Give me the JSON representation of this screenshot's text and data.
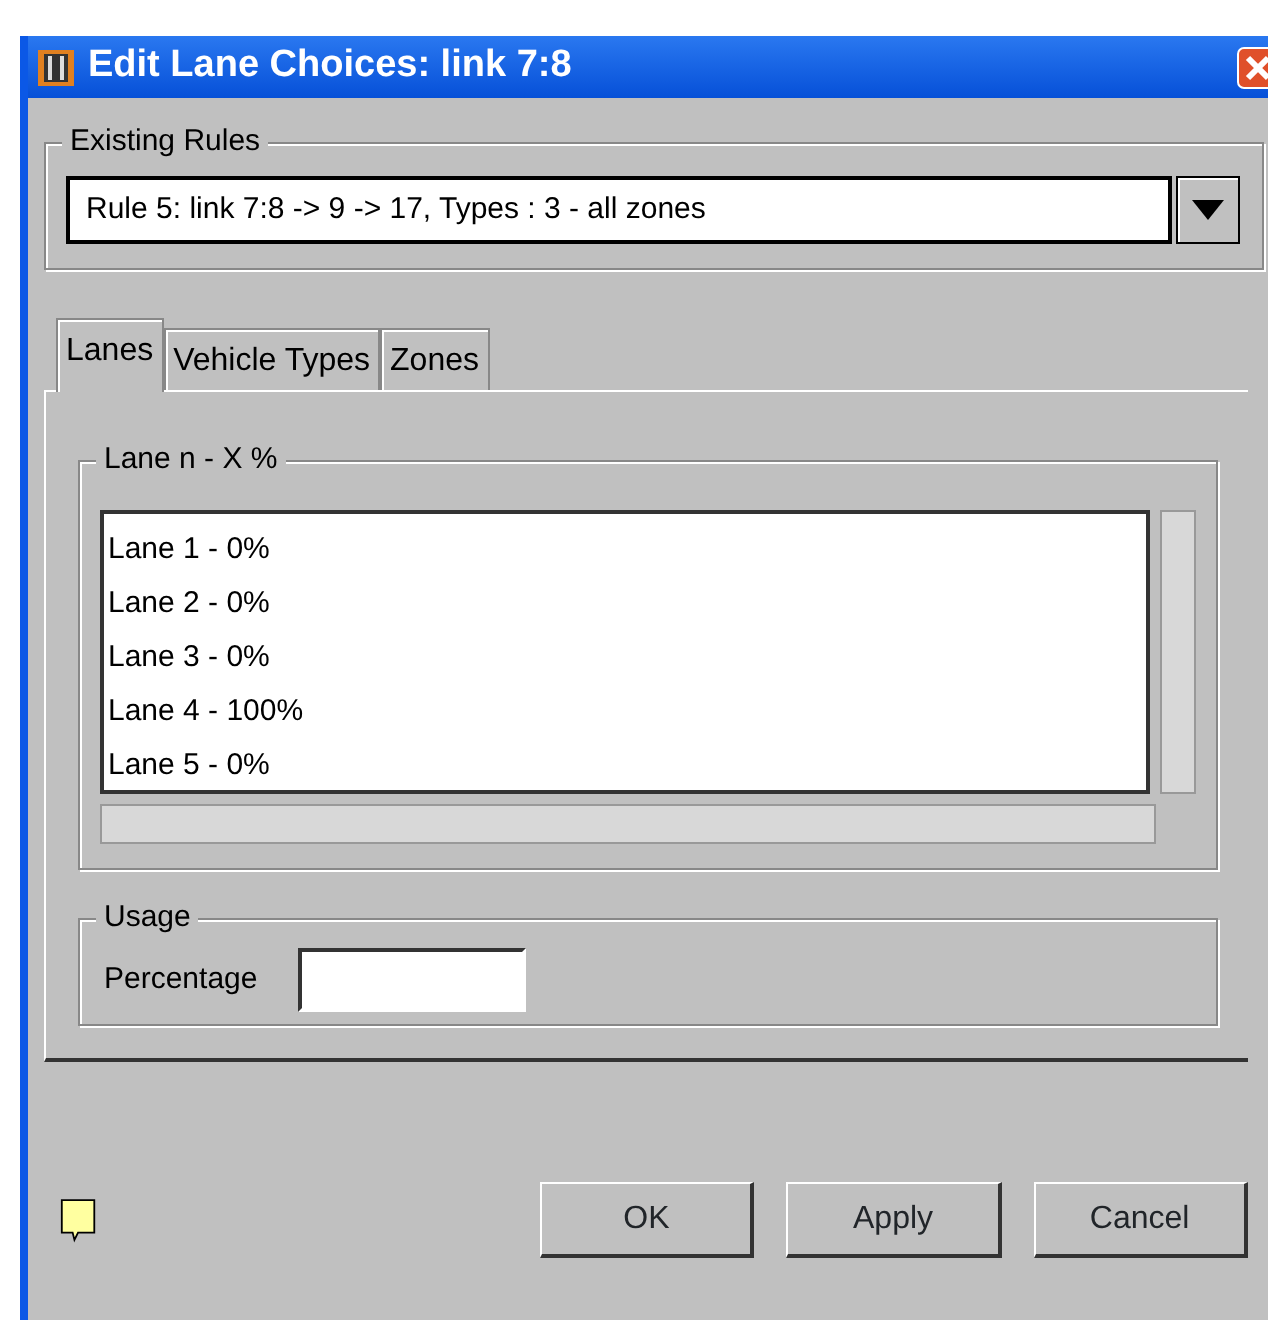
{
  "window": {
    "title": "Edit Lane Choices: link 7:8"
  },
  "existing_rules": {
    "legend": "Existing Rules",
    "value": "Rule 5: link 7:8 -> 9 -> 17, Types : 3 -  all zones"
  },
  "tabs": [
    {
      "label": "Lanes",
      "selected": true
    },
    {
      "label": "Vehicle Types",
      "selected": false
    },
    {
      "label": "Zones",
      "selected": false
    }
  ],
  "lanes": {
    "legend": "Lane n - X %",
    "items": [
      "Lane 1 - 0%",
      "Lane 2 - 0%",
      "Lane 3 - 0%",
      "Lane 4 - 100%",
      "Lane 5 - 0%"
    ]
  },
  "usage": {
    "legend": "Usage",
    "label": "Percentage"
  },
  "buttons": [
    "OK",
    "Apply",
    "Cancel"
  ]
}
